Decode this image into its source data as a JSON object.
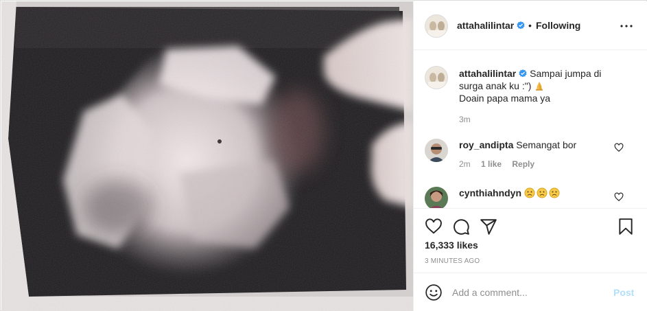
{
  "post": {
    "username": "attahalilintar",
    "separator": "•",
    "follow_status": "Following",
    "caption_line1": "Sampai jumpa di surga anak ku :\") ",
    "caption_line2": "Doain papa mama ya",
    "caption_emoji": "folded-hands",
    "caption_time": "3m",
    "likes": "16,333 likes",
    "posted": "3 MINUTES AGO"
  },
  "comments": [
    {
      "username": "roy_andipta",
      "text": "Semangat bor",
      "time": "2m",
      "likes": "1 like",
      "reply": "Reply"
    },
    {
      "username": "cynthiahndyn",
      "emojis": [
        "sad-face",
        "sad-face",
        "sad-face"
      ]
    }
  ],
  "add_comment": {
    "placeholder": "Add a comment...",
    "post_label": "Post"
  },
  "icons": {
    "more": "more-horizontal-icon",
    "like": "heart-icon",
    "comment": "comment-icon",
    "share": "send-icon",
    "save": "bookmark-icon",
    "emoji": "smiley-icon",
    "verified": "verified-badge-icon"
  },
  "colors": {
    "verified": "#3897f0",
    "post_disabled": "#b2dffc",
    "muted_text": "#8e8e8e"
  }
}
